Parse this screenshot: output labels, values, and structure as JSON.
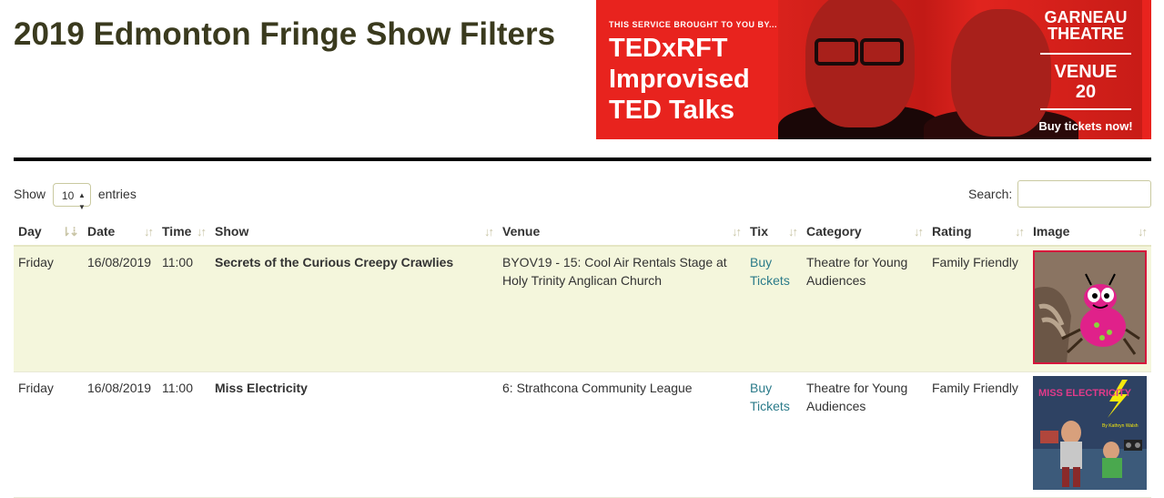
{
  "page": {
    "title": "2019 Edmonton Fringe Show Filters"
  },
  "banner": {
    "small_text": "THIS SERVICE BROUGHT TO YOU BY...",
    "line1": "TEDxRFT",
    "line2": "Improvised",
    "line3": "TED Talks",
    "venue_name_1": "GARNEAU",
    "venue_name_2": "THEATRE",
    "venue_label": "VENUE",
    "venue_number": "20",
    "cta": "Buy tickets now!",
    "color": "#e8231e"
  },
  "controls": {
    "show_label": "Show",
    "entries_value": "10",
    "entries_label": "entries",
    "search_label": "Search:",
    "search_value": ""
  },
  "table": {
    "columns": [
      "Day",
      "Date",
      "Time",
      "Show",
      "Venue",
      "Tix",
      "Category",
      "Rating",
      "Image"
    ],
    "sort_icons": [
      "sort-asc-icon",
      "sort-both-icon"
    ],
    "rows": [
      {
        "day": "Friday",
        "date": "16/08/2019",
        "time": "11:00",
        "show": "Secrets of the Curious Creepy Crawlies",
        "venue": "BYOV19 - 15: Cool Air Rentals Stage at Holy Trinity Anglican Church",
        "tix": "Buy Tickets",
        "category": "Theatre for Young Audiences",
        "rating": "Family Friendly",
        "image": "creepy-crawlies-poster"
      },
      {
        "day": "Friday",
        "date": "16/08/2019",
        "time": "11:00",
        "show": "Miss Electricity",
        "venue": "6: Strathcona Community League",
        "tix": "Buy Tickets",
        "category": "Theatre for Young Audiences",
        "rating": "Family Friendly",
        "image": "miss-electricity-poster",
        "image_title": "MISS ELECTRICITY",
        "image_credit": "By Kathryn Walsh"
      }
    ]
  },
  "colors": {
    "accent_link": "#2b7b8a",
    "row_highlight": "#f4f6dc",
    "title": "#3a3a1e"
  }
}
